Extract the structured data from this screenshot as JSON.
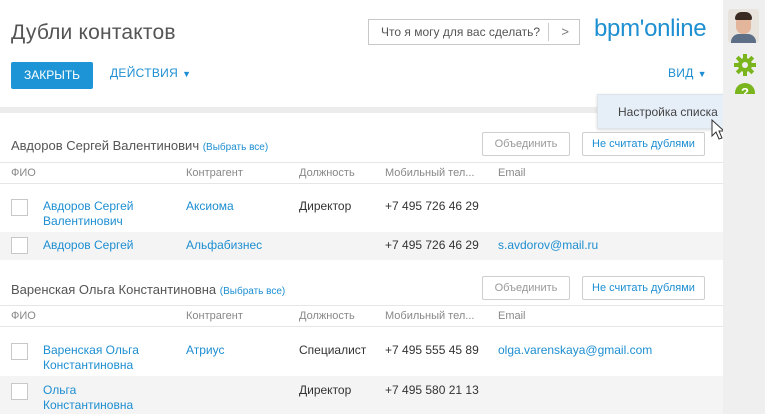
{
  "page": {
    "title": "Дубли контактов"
  },
  "command_line": {
    "placeholder": "Что я могу для вас сделать?",
    "go_icon": "chevron-right-icon"
  },
  "logo": {
    "text": "bpm'online"
  },
  "toolbar": {
    "close_label": "ЗАКРЫТЬ",
    "actions_label": "ДЕЙСТВИЯ",
    "view_label": "ВИД"
  },
  "view_menu": {
    "items": [
      {
        "label": "Настройка списка"
      }
    ]
  },
  "columns": [
    "ФИО",
    "Контрагент",
    "Должность",
    "Мобильный тел...",
    "Email"
  ],
  "groups": [
    {
      "title": "Авдоров Сергей Валентинович",
      "select_all": "(Выбрать все)",
      "merge_label": "Объединить",
      "not_duplicates_label": "Не считать дублями",
      "rows": [
        {
          "fio": "Авдоров Сергей Валентинович",
          "account": "Аксиома",
          "position": "Директор",
          "mobile": "+7 495 726 46 29",
          "email": ""
        },
        {
          "fio": "Авдоров Сергей",
          "account": "Альфабизнес",
          "position": "",
          "mobile": "+7 495 726 46 29",
          "email": "s.avdorov@mail.ru"
        }
      ]
    },
    {
      "title": "Варенская Ольга Константиновна",
      "select_all": "(Выбрать все)",
      "merge_label": "Объединить",
      "not_duplicates_label": "Не считать дублями",
      "rows": [
        {
          "fio": "Варенская Ольга Константиновна",
          "account": "Атриус",
          "position": "Специалист",
          "mobile": "+7 495 555 45 89",
          "email": "olga.varenskaya@gmail.com"
        },
        {
          "fio": "Ольга Константиновна",
          "account": "",
          "position": "Директор",
          "mobile": "+7 495 580 21 13",
          "email": ""
        }
      ]
    }
  ],
  "sidebar": {
    "icons": [
      "user-avatar",
      "gear-icon",
      "help-icon"
    ]
  },
  "colors": {
    "accent": "#1d94d6",
    "link": "#1d8ed1",
    "sidebar_icon": "#7ab51d"
  }
}
